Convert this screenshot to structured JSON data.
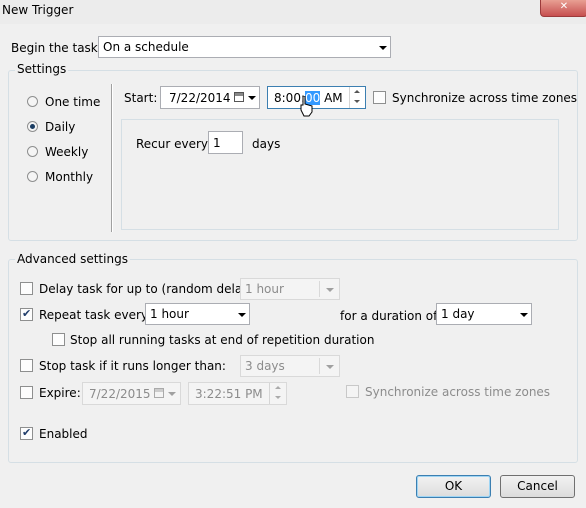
{
  "window": {
    "title": "New Trigger",
    "close_glyph": "✕"
  },
  "begin_task": {
    "label": "Begin the task:",
    "value": "On a schedule"
  },
  "settings": {
    "legend": "Settings",
    "schedule_options": [
      {
        "label": "One time",
        "selected": false
      },
      {
        "label": "Daily",
        "selected": true
      },
      {
        "label": "Weekly",
        "selected": false
      },
      {
        "label": "Monthly",
        "selected": false
      }
    ],
    "start_label": "Start:",
    "start_date": "7/22/2014",
    "start_time_prefix": "8:00:",
    "start_time_selected": "00",
    "start_time_suffix": " AM",
    "sync_label": "Synchronize across time zones",
    "recur_label": "Recur every:",
    "recur_value": "1",
    "recur_unit": "days"
  },
  "advanced": {
    "legend": "Advanced settings",
    "delay": {
      "label": "Delay task for up to (random delay):",
      "value": "1 hour",
      "checked": false
    },
    "repeat": {
      "label": "Repeat task every:",
      "value": "1 hour",
      "checked": true,
      "duration_label": "for a duration of:",
      "duration_value": "1 day"
    },
    "stop_all": {
      "label": "Stop all running tasks at end of repetition duration",
      "checked": false
    },
    "stop_longer": {
      "label": "Stop task if it runs longer than:",
      "value": "3 days",
      "checked": false
    },
    "expire": {
      "label": "Expire:",
      "date": "7/22/2015",
      "time": "3:22:51 PM",
      "checked": false,
      "sync_label": "Synchronize across time zones"
    },
    "enabled": {
      "label": "Enabled",
      "checked": true
    }
  },
  "buttons": {
    "ok": "OK",
    "cancel": "Cancel"
  },
  "icons": [
    "calendar-icon",
    "dropdown-arrow-icon",
    "spin-up-icon",
    "spin-down-icon",
    "checkmark-icon",
    "mouse-cursor-icon"
  ]
}
